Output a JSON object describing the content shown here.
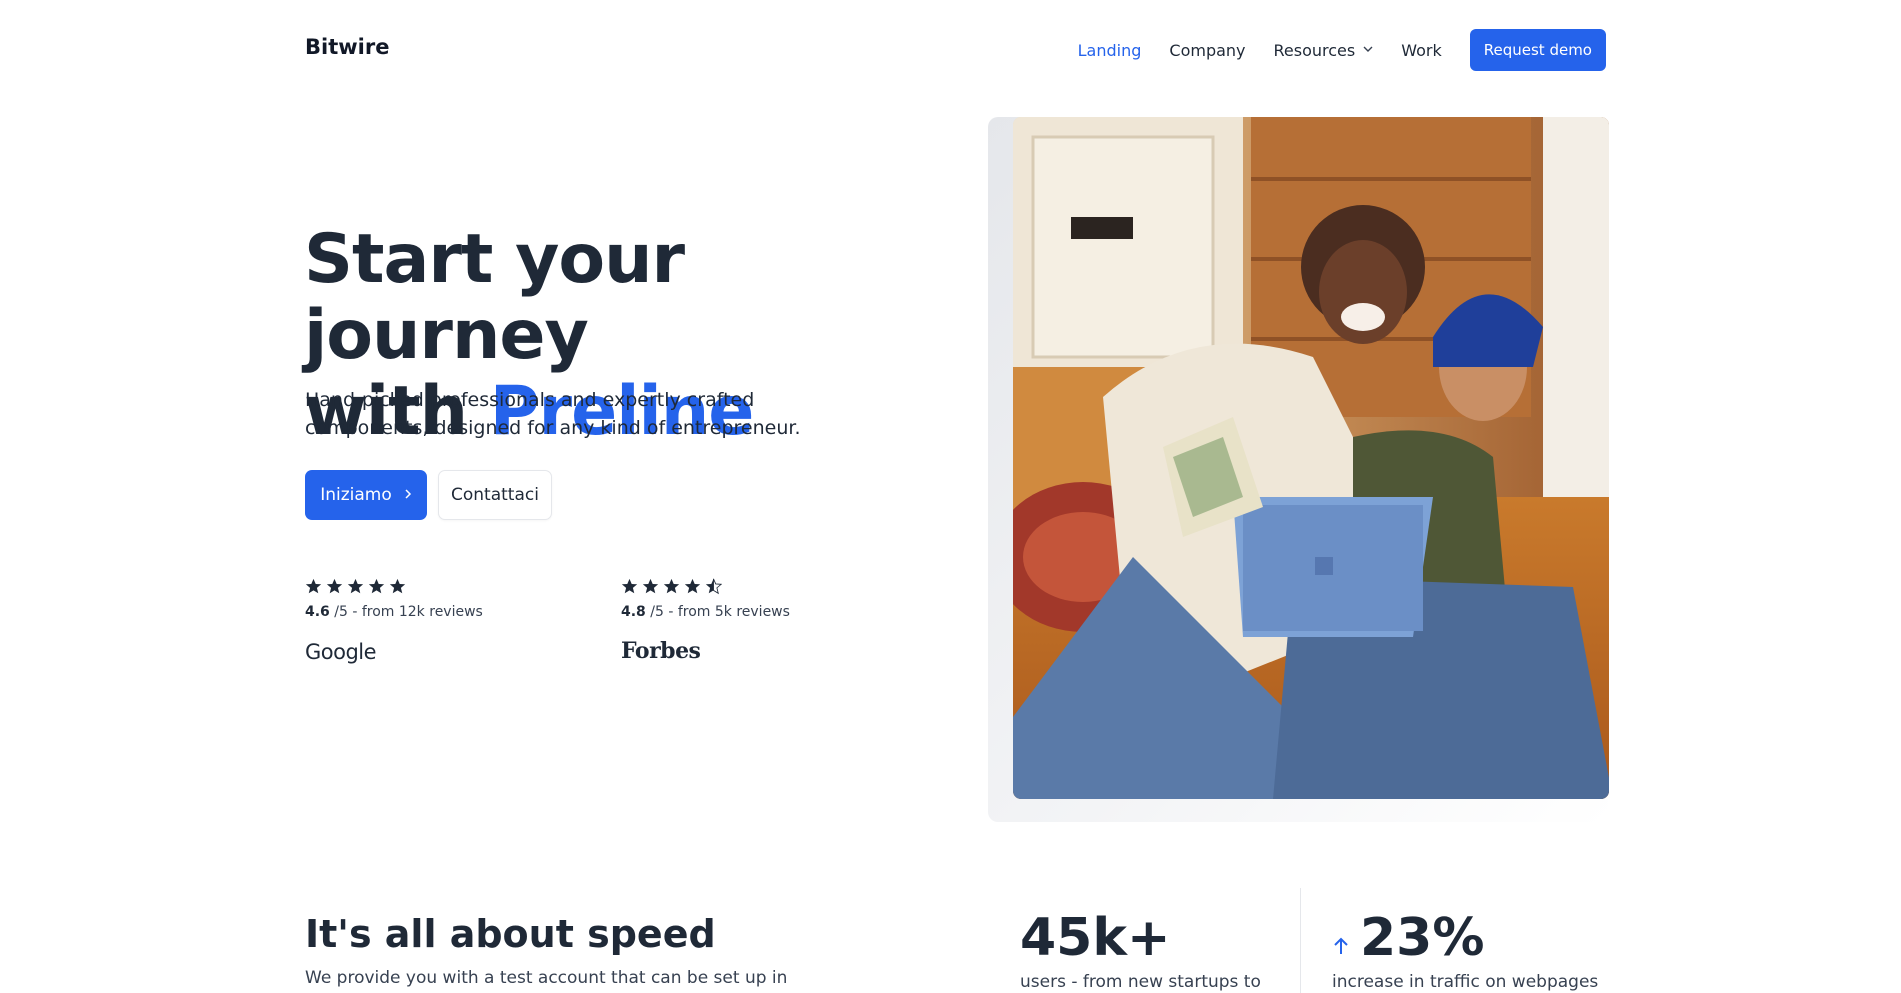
{
  "header": {
    "brand": "Bitwire",
    "nav": [
      {
        "label": "Landing",
        "active": true
      },
      {
        "label": "Company",
        "active": false
      },
      {
        "label": "Resources",
        "active": false,
        "has_dropdown": true
      },
      {
        "label": "Work",
        "active": false
      }
    ],
    "cta_label": "Request demo"
  },
  "hero": {
    "title_line1": "Start your journey",
    "title_line2_prefix": "with ",
    "title_accent": "Preline",
    "subtitle": "Hand-picked professionals and expertly crafted components, designed for any kind of entrepreneur.",
    "primary_button": "Iniziamo",
    "secondary_button": "Contattaci",
    "reviews": [
      {
        "stars": 5,
        "rating": "4.6",
        "rating_suffix": " /5 - from 12k reviews",
        "source": "Google"
      },
      {
        "stars": 4.5,
        "rating": "4.8",
        "rating_suffix": " /5 - from 5k reviews",
        "source": "Forbes"
      }
    ]
  },
  "speed_section": {
    "title": "It's all about speed",
    "text": "We provide you with a test account that can be set up in seconds. Our main focus is getting responses to you as soon as"
  },
  "stats": [
    {
      "value": "45k+",
      "label": "users - from new startups to"
    },
    {
      "value": "23%",
      "label": "increase in traffic on webpages",
      "icon": "arrow-up-icon"
    }
  ],
  "colors": {
    "accent": "#2563eb",
    "text": "#1f2937"
  }
}
